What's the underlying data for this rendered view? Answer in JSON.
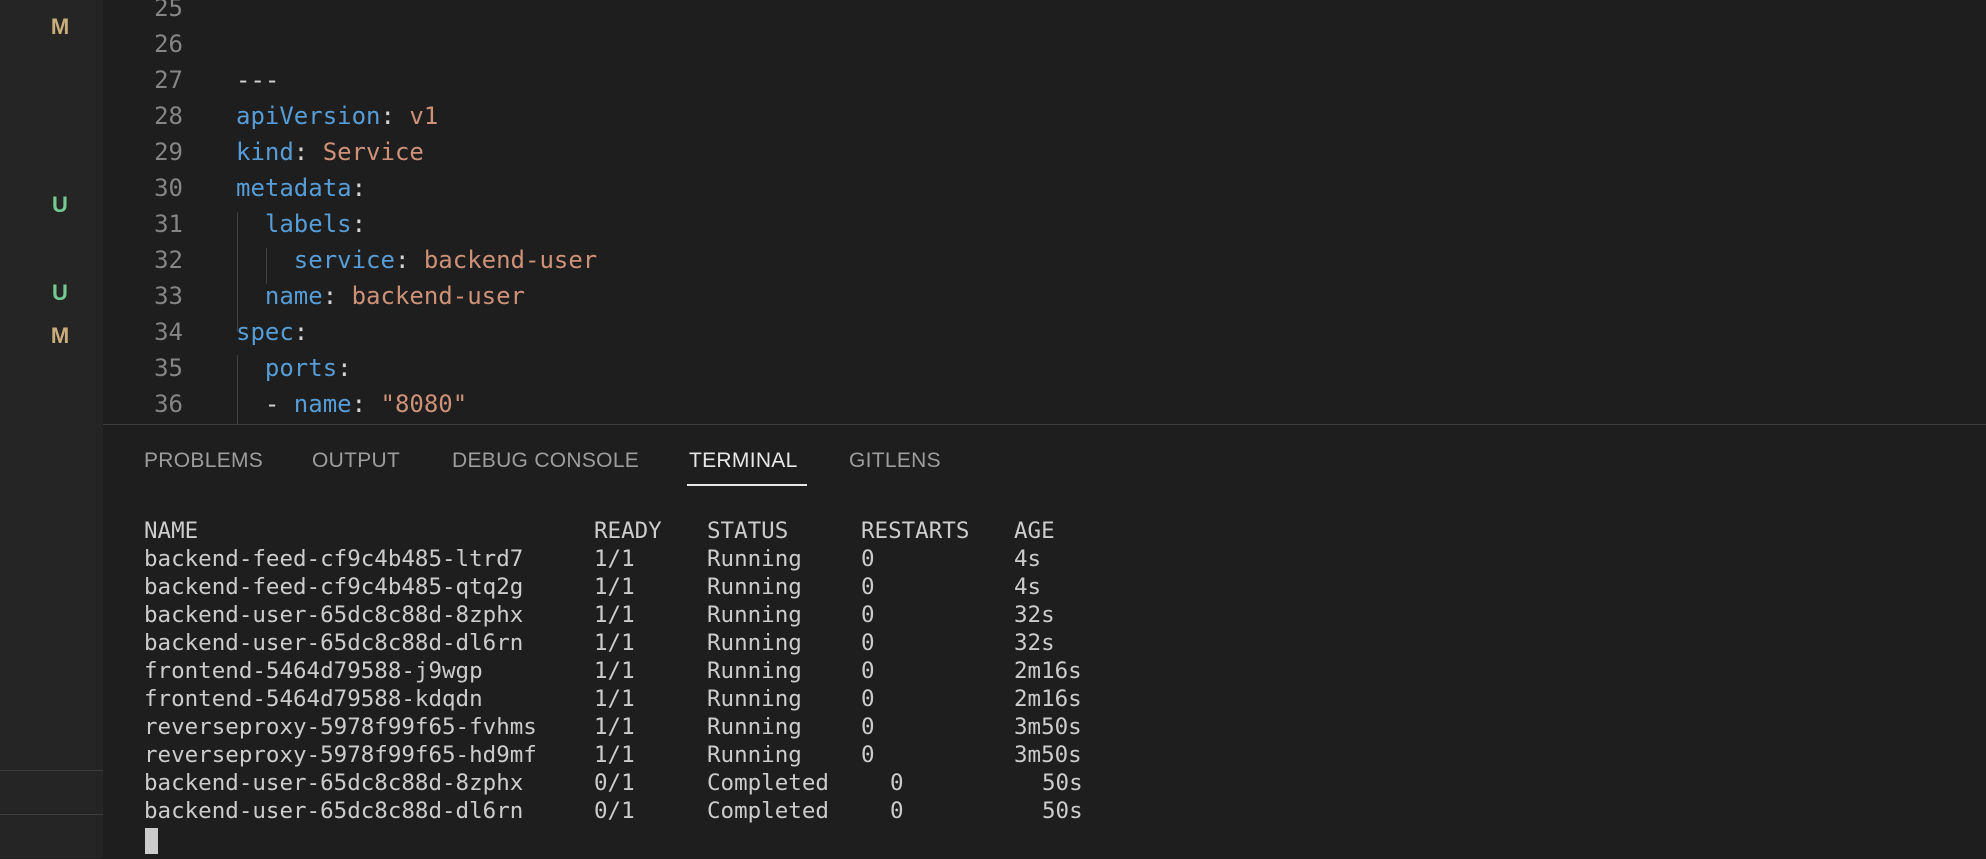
{
  "sidebar": {
    "badges": [
      {
        "letter": "M",
        "color": "#c9ae7c"
      },
      {
        "letter": "U",
        "color": "#73c991"
      },
      {
        "letter": "U",
        "color": "#73c991"
      },
      {
        "letter": "M",
        "color": "#c9ae7c"
      }
    ]
  },
  "editor": {
    "lines": [
      {
        "num": "25",
        "tokens": []
      },
      {
        "num": "26",
        "tokens": []
      },
      {
        "num": "27",
        "tokens": [
          {
            "t": "---",
            "c": "p"
          }
        ]
      },
      {
        "num": "28",
        "tokens": [
          {
            "t": "apiVersion",
            "c": "k"
          },
          {
            "t": ": ",
            "c": "p"
          },
          {
            "t": "v1",
            "c": "v"
          }
        ]
      },
      {
        "num": "29",
        "tokens": [
          {
            "t": "kind",
            "c": "k"
          },
          {
            "t": ": ",
            "c": "p"
          },
          {
            "t": "Service",
            "c": "v"
          }
        ]
      },
      {
        "num": "30",
        "tokens": [
          {
            "t": "metadata",
            "c": "k"
          },
          {
            "t": ":",
            "c": "p"
          }
        ]
      },
      {
        "num": "31",
        "tokens": [
          {
            "t": "  labels",
            "c": "k"
          },
          {
            "t": ":",
            "c": "p"
          }
        ]
      },
      {
        "num": "32",
        "tokens": [
          {
            "t": "    service",
            "c": "k"
          },
          {
            "t": ": ",
            "c": "p"
          },
          {
            "t": "backend-user",
            "c": "v"
          }
        ]
      },
      {
        "num": "33",
        "tokens": [
          {
            "t": "  name",
            "c": "k"
          },
          {
            "t": ": ",
            "c": "p"
          },
          {
            "t": "backend-user",
            "c": "v"
          }
        ]
      },
      {
        "num": "34",
        "tokens": [
          {
            "t": "spec",
            "c": "k"
          },
          {
            "t": ":",
            "c": "p"
          }
        ]
      },
      {
        "num": "35",
        "tokens": [
          {
            "t": "  ports",
            "c": "k"
          },
          {
            "t": ":",
            "c": "p"
          }
        ]
      },
      {
        "num": "36",
        "tokens": [
          {
            "t": "  - ",
            "c": "p"
          },
          {
            "t": "name",
            "c": "k"
          },
          {
            "t": ": ",
            "c": "p"
          },
          {
            "t": "\"8080\"",
            "c": "v"
          }
        ]
      }
    ]
  },
  "panel": {
    "tabs": [
      {
        "label": "PROBLEMS",
        "active": false
      },
      {
        "label": "OUTPUT",
        "active": false
      },
      {
        "label": "DEBUG CONSOLE",
        "active": false
      },
      {
        "label": "TERMINAL",
        "active": true
      },
      {
        "label": "GITLENS",
        "active": false
      }
    ]
  },
  "terminal": {
    "header": {
      "name": "NAME",
      "ready": "READY",
      "status": "STATUS",
      "restarts": "RESTARTS",
      "age": "AGE"
    },
    "rows": [
      {
        "name": "backend-feed-cf9c4b485-ltrd7",
        "ready": "1/1",
        "status": "Running",
        "restarts": "0",
        "age": "4s",
        "shift": false
      },
      {
        "name": "backend-feed-cf9c4b485-qtq2g",
        "ready": "1/1",
        "status": "Running",
        "restarts": "0",
        "age": "4s",
        "shift": false
      },
      {
        "name": "backend-user-65dc8c88d-8zphx",
        "ready": "1/1",
        "status": "Running",
        "restarts": "0",
        "age": "32s",
        "shift": false
      },
      {
        "name": "backend-user-65dc8c88d-dl6rn",
        "ready": "1/1",
        "status": "Running",
        "restarts": "0",
        "age": "32s",
        "shift": false
      },
      {
        "name": "frontend-5464d79588-j9wgp",
        "ready": "1/1",
        "status": "Running",
        "restarts": "0",
        "age": "2m16s",
        "shift": false
      },
      {
        "name": "frontend-5464d79588-kdqdn",
        "ready": "1/1",
        "status": "Running",
        "restarts": "0",
        "age": "2m16s",
        "shift": false
      },
      {
        "name": "reverseproxy-5978f99f65-fvhms",
        "ready": "1/1",
        "status": "Running",
        "restarts": "0",
        "age": "3m50s",
        "shift": false
      },
      {
        "name": "reverseproxy-5978f99f65-hd9mf",
        "ready": "1/1",
        "status": "Running",
        "restarts": "0",
        "age": "3m50s",
        "shift": false
      },
      {
        "name": "backend-user-65dc8c88d-8zphx",
        "ready": "0/1",
        "status": "Completed",
        "restarts": "0",
        "age": "50s",
        "shift": true
      },
      {
        "name": "backend-user-65dc8c88d-dl6rn",
        "ready": "0/1",
        "status": "Completed",
        "restarts": "0",
        "age": "50s",
        "shift": true
      }
    ]
  }
}
